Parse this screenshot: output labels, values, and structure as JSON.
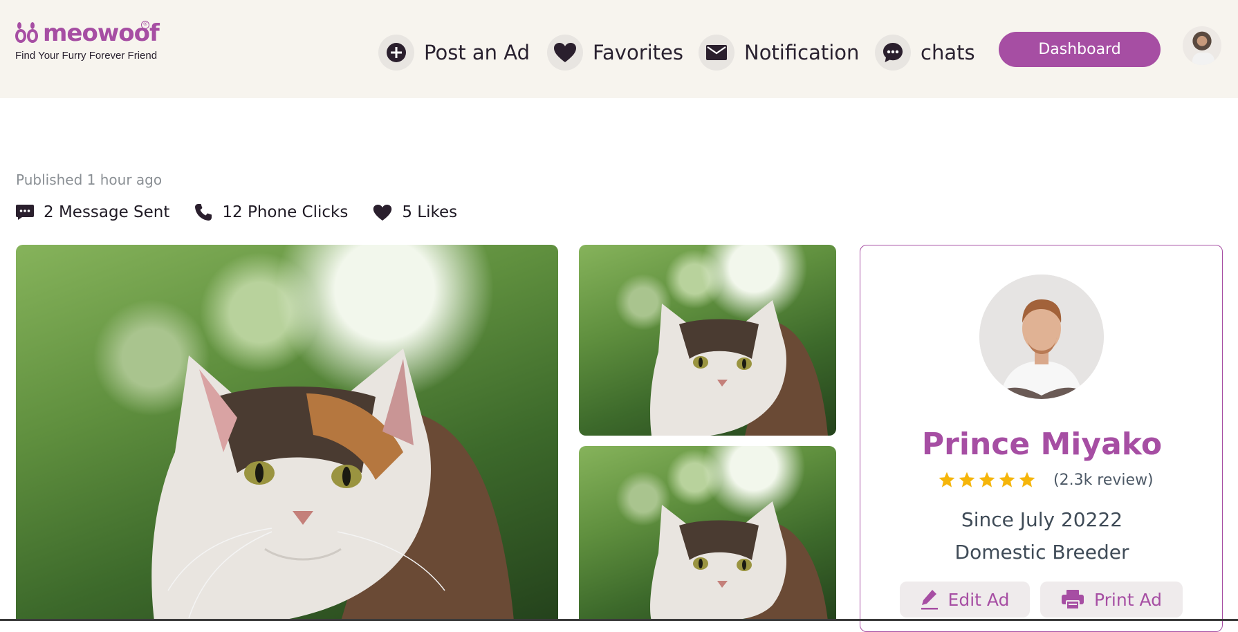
{
  "brand": {
    "name": "meowoof",
    "registered_mark": "®",
    "tagline": "Find Your Furry Forever Friend",
    "color": "#a64ea3"
  },
  "nav": {
    "items": [
      {
        "label": "Post an Ad",
        "icon": "plus-circle-icon"
      },
      {
        "label": "Favorites",
        "icon": "heart-icon"
      },
      {
        "label": "Notification",
        "icon": "envelope-icon"
      },
      {
        "label": "chats",
        "icon": "chat-bubble-icon"
      }
    ],
    "dashboard_label": "Dashboard"
  },
  "listing": {
    "published": "Published 1 hour ago",
    "stats": [
      {
        "label": "2 Message Sent",
        "icon": "message-icon"
      },
      {
        "label": "12 Phone Clicks",
        "icon": "phone-icon"
      },
      {
        "label": "5 Likes",
        "icon": "heart-icon"
      }
    ]
  },
  "seller": {
    "name": "Prince Miyako",
    "rating_stars": 5,
    "reviews": "(2.3k review)",
    "since": "Since July 20222",
    "type": "Domestic Breeder",
    "edit_label": "Edit Ad",
    "print_label": "Print Ad"
  },
  "colors": {
    "accent": "#a64ea3",
    "header_bg": "#f7f4ee",
    "star": "#f5b50a"
  }
}
